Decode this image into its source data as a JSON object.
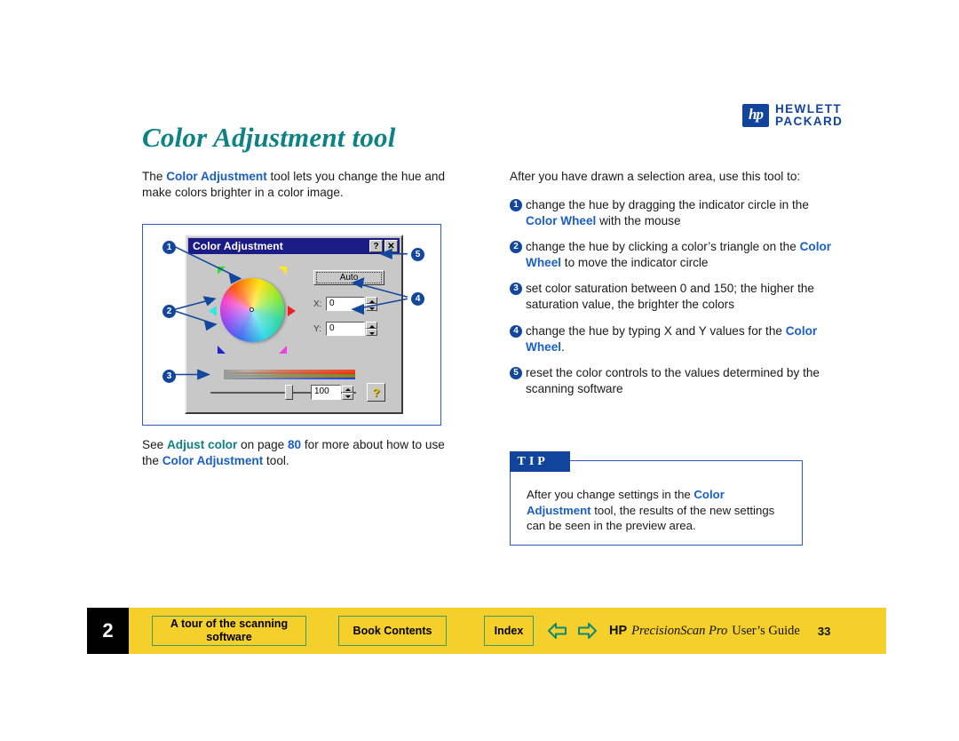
{
  "logo": {
    "mark": "hp",
    "line1": "HEWLETT",
    "line2": "PACKARD"
  },
  "title": "Color Adjustment tool",
  "left_column": {
    "intro_pre": "The ",
    "intro_link": "Color Adjustment",
    "intro_post": " tool lets you change the hue and make colors brighter in a color image.",
    "see_also": {
      "pre": "See ",
      "link1": "Adjust color",
      "mid1": " on page ",
      "pagenum": "80",
      "mid2": " for more about how to use the ",
      "link2": "Color Adjustment",
      "post": " tool."
    }
  },
  "right_column": {
    "intro": "After you have drawn a selection area, use this tool to:",
    "items": [
      {
        "num": "1",
        "pre": "change the hue by dragging the indicator circle in the ",
        "link": "Color Wheel",
        "post": " with the mouse"
      },
      {
        "num": "2",
        "pre": "change the hue by clicking a color’s triangle on the ",
        "link": "Color Wheel",
        "post": " to move the indicator circle"
      },
      {
        "num": "3",
        "pre": "set color saturation between 0 and 150; the higher the saturation value, the brighter the colors",
        "link": "",
        "post": ""
      },
      {
        "num": "4",
        "pre": "change the hue by typing X and Y values for the ",
        "link": "Color Wheel",
        "post": "."
      },
      {
        "num": "5",
        "pre": "reset the color controls to the values determined by the scanning software",
        "link": "",
        "post": ""
      }
    ]
  },
  "tip": {
    "label": "TIP",
    "pre": "After you change settings in the ",
    "link": "Color Adjustment",
    "post": " tool, the results of the new settings can be seen in the preview area."
  },
  "dialog": {
    "title": "Color Adjustment",
    "help_title_button": "?",
    "close_button": "✕",
    "auto_button": "Auto",
    "x_label": "X:",
    "x_value": "0",
    "y_label": "Y:",
    "y_value": "0",
    "saturation_value": "100",
    "help_button": "?",
    "callouts": [
      "1",
      "2",
      "3",
      "4",
      "5"
    ],
    "wheel_triangles": [
      "green",
      "yellow",
      "cyan",
      "red",
      "blue",
      "magenta"
    ]
  },
  "footer": {
    "chapter": "2",
    "tour_button": "A tour of the scanning software",
    "contents_button": "Book Contents",
    "index_button": "Index",
    "prev_arrow": "back-arrow",
    "next_arrow": "forward-arrow",
    "brand": "HP",
    "product": "PrecisionScan Pro",
    "guide": "User’s Guide",
    "page": "33"
  },
  "colors": {
    "title_teal": "#0d8284",
    "link_blue": "#1a5fc4",
    "link_teal": "#0d8284",
    "callout_blue": "#13479e",
    "footer_yellow": "#f5cf2a",
    "footer_border_green": "#3d9a6b",
    "tip_border": "#2a5bbd",
    "dialog_title_blue": "#1b1b86"
  }
}
